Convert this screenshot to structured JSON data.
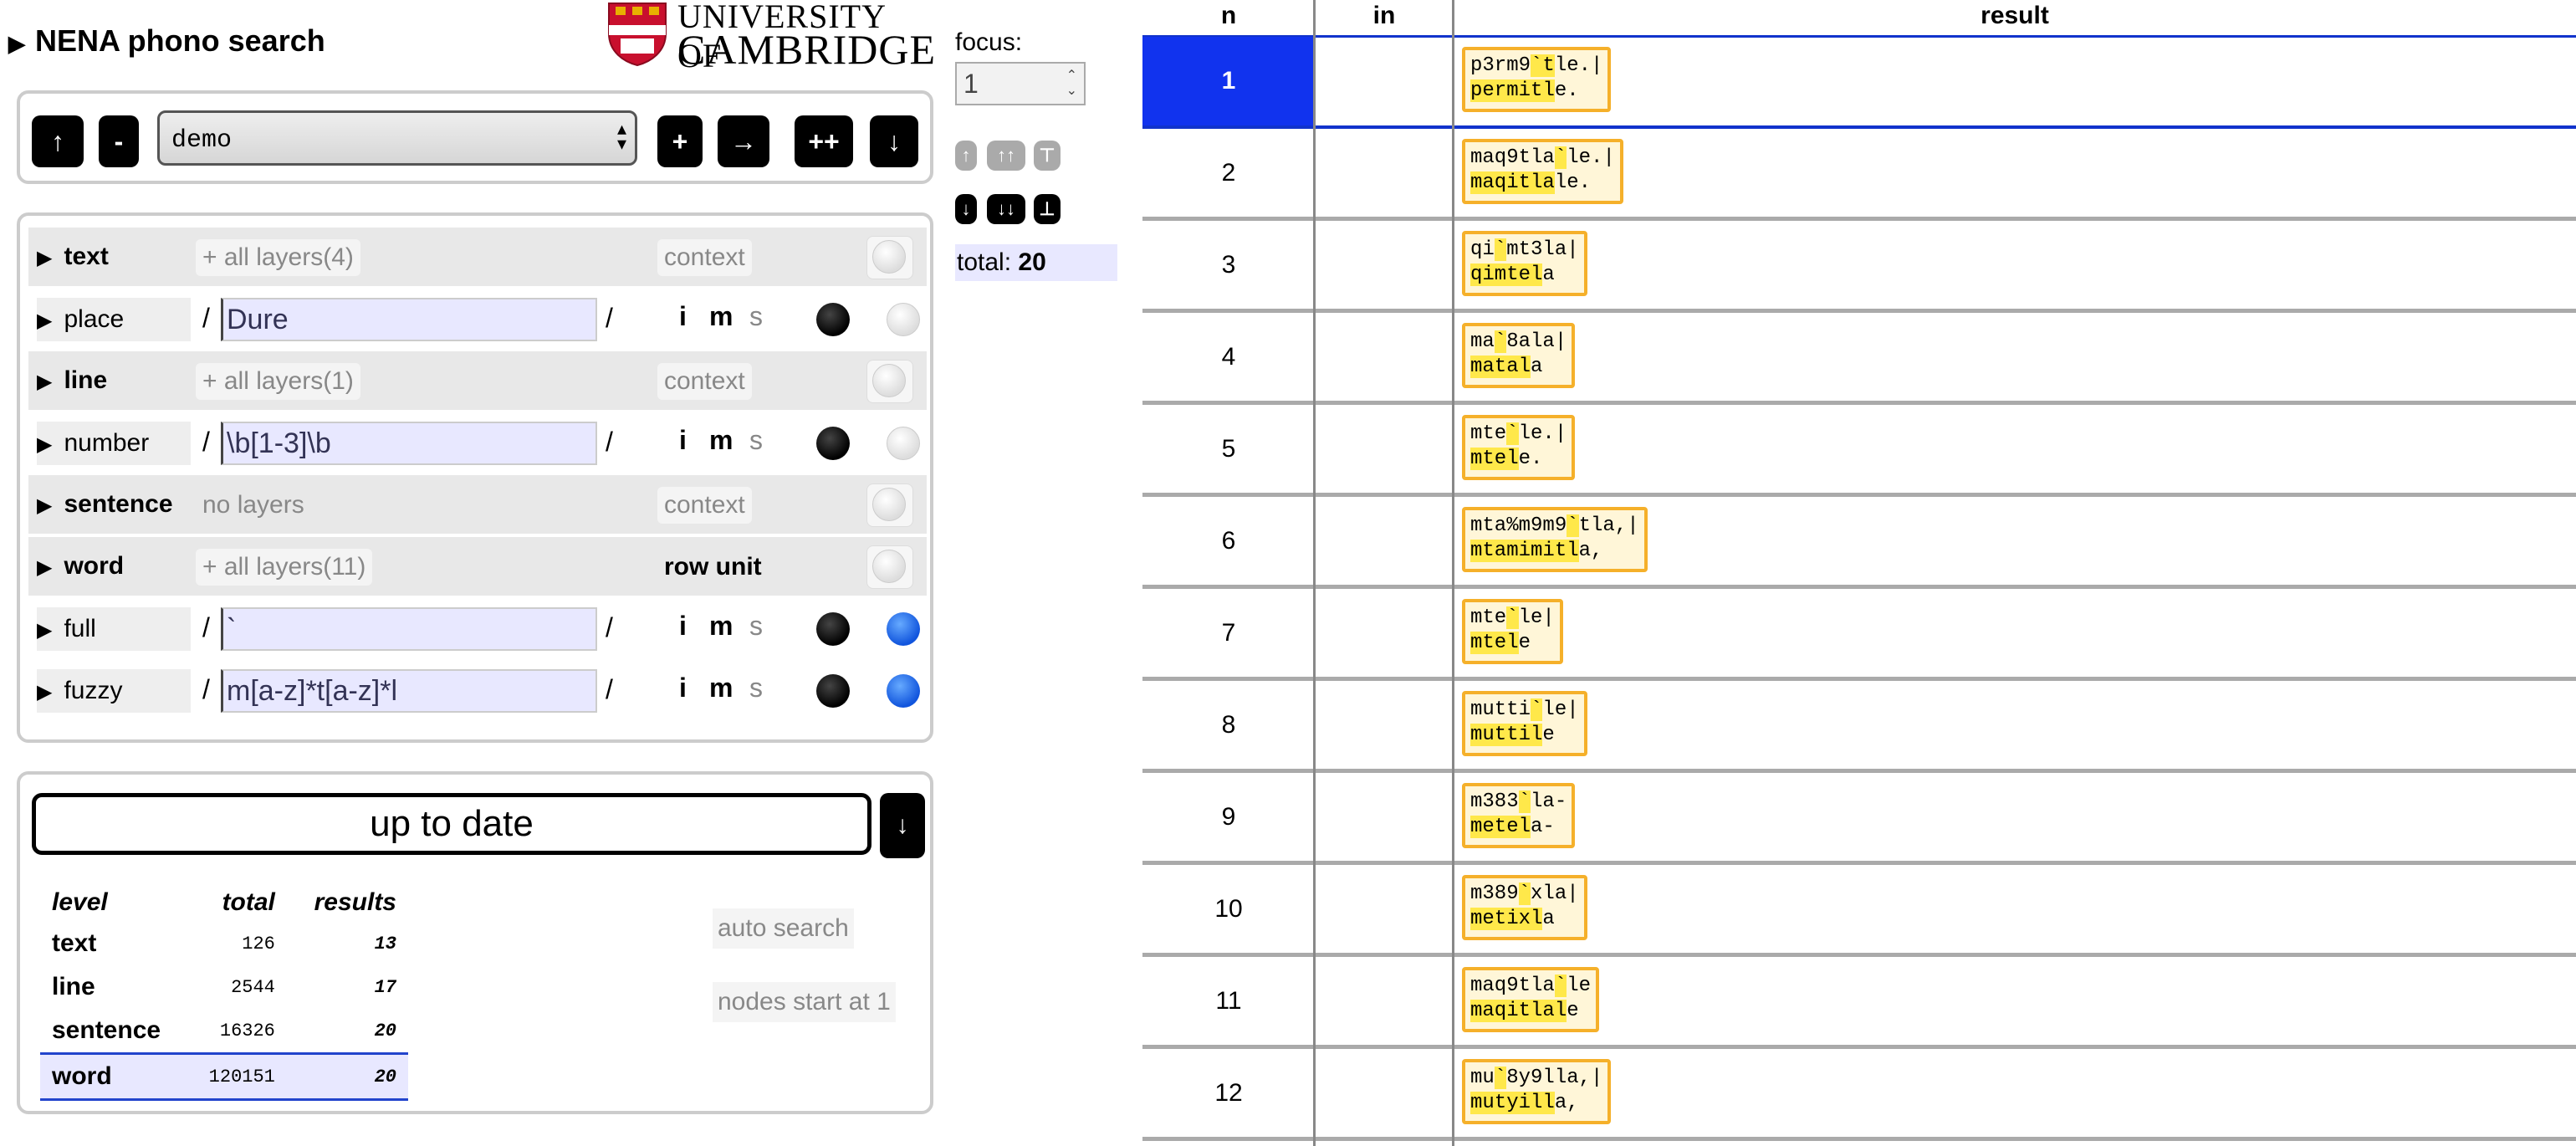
{
  "header": {
    "title": "NENA phono search",
    "logo_line1": "UNIVERSITY OF",
    "logo_line2": "CAMBRIDGE"
  },
  "sets": {
    "up": "↑",
    "minus": "-",
    "selected": "demo",
    "plus": "+",
    "arrow": "→",
    "plusplus": "++",
    "down": "↓"
  },
  "query": {
    "rows": [
      {
        "name": "text",
        "kind": "layer",
        "layers": "+ all layers(4)",
        "context": "context"
      },
      {
        "name": "place",
        "kind": "pattern",
        "pattern": "Dure",
        "i": "i",
        "m": "m",
        "s": "s",
        "dot": "grey"
      },
      {
        "name": "line",
        "kind": "layer",
        "layers": "+ all layers(1)",
        "context": "context"
      },
      {
        "name": "number",
        "kind": "pattern",
        "pattern": "\\b[1-3]\\b",
        "i": "i",
        "m": "m",
        "s": "s",
        "dot": "grey"
      },
      {
        "name": "sentence",
        "kind": "layer",
        "layers": "no layers",
        "context": "context"
      },
      {
        "name": "word",
        "kind": "layer",
        "layers": "+ all layers(11)",
        "context": "row unit"
      },
      {
        "name": "full",
        "kind": "pattern",
        "pattern": "`",
        "i": "i",
        "m": "m",
        "s": "s",
        "dot": "blue"
      },
      {
        "name": "fuzzy",
        "kind": "pattern",
        "pattern": "m[a-z]*t[a-z]*l",
        "i": "i",
        "m": "m",
        "s": "s",
        "dot": "blue"
      }
    ],
    "slash": "/"
  },
  "status": {
    "message": "up to date",
    "down": "↓",
    "headers": {
      "level": "level",
      "total": "total",
      "results": "results"
    },
    "levels": [
      {
        "level": "text",
        "total": "126",
        "results": "13"
      },
      {
        "level": "line",
        "total": "2544",
        "results": "17"
      },
      {
        "level": "sentence",
        "total": "16326",
        "results": "20"
      },
      {
        "level": "word",
        "total": "120151",
        "results": "20"
      }
    ],
    "auto_search": "auto search",
    "nodes_start": "nodes start at 1"
  },
  "focus": {
    "label": "focus:",
    "value": "1"
  },
  "nav_up": [
    "↑",
    "↑↑",
    "⊤"
  ],
  "nav_down": [
    "↓",
    "↓↓",
    "⊥"
  ],
  "total": {
    "label": "total:",
    "value": "20"
  },
  "results": {
    "headers": {
      "n": "n",
      "in": "in",
      "result": "result"
    },
    "rows": [
      {
        "n": "1",
        "line1": [
          "p3rm9",
          "`",
          "t",
          "le.|"
        ],
        "line2": [
          "per",
          "mit",
          "l",
          "e."
        ]
      },
      {
        "n": "2",
        "line1": [
          "maq9tla",
          "`",
          "",
          "le.|"
        ],
        "line2": [
          "maqitla",
          "",
          "",
          "le."
        ]
      },
      {
        "n": "3",
        "line1": [
          "qi",
          "`",
          "",
          "mt3la|"
        ],
        "line2": [
          "qimtel",
          "",
          "",
          "a"
        ]
      },
      {
        "n": "4",
        "line1": [
          "ma",
          "`",
          "",
          "8ala|"
        ],
        "line2": [
          "matal",
          "",
          "",
          "a"
        ]
      },
      {
        "n": "5",
        "line1": [
          "mte",
          "`",
          "",
          "le.|"
        ],
        "line2": [
          "mtel",
          "",
          "",
          "e."
        ]
      },
      {
        "n": "6",
        "line1": [
          "mta%m9m9",
          "`",
          "",
          "tla,|"
        ],
        "line2": [
          "mtamimitl",
          "",
          "",
          "a,"
        ]
      },
      {
        "n": "7",
        "line1": [
          "mte",
          "`",
          "",
          "le|"
        ],
        "line2": [
          "mtel",
          "",
          "",
          "e"
        ]
      },
      {
        "n": "8",
        "line1": [
          "mutti",
          "`",
          "",
          "le|"
        ],
        "line2": [
          "muttil",
          "",
          "",
          "e"
        ]
      },
      {
        "n": "9",
        "line1": [
          "m383",
          "`",
          "",
          "la-"
        ],
        "line2": [
          "metel",
          "",
          "",
          "a-"
        ]
      },
      {
        "n": "10",
        "line1": [
          "m389",
          "`",
          "",
          "xla|"
        ],
        "line2": [
          "metixl",
          "",
          "",
          "a"
        ]
      },
      {
        "n": "11",
        "line1": [
          "maq9tla",
          "`",
          "",
          "le"
        ],
        "line2": [
          "maqitlal",
          "",
          "",
          "e"
        ]
      },
      {
        "n": "12",
        "line1": [
          "mu",
          "`",
          "",
          "8y9lla,|"
        ],
        "line2": [
          "mutyill",
          "",
          "",
          "a,"
        ]
      }
    ]
  }
}
